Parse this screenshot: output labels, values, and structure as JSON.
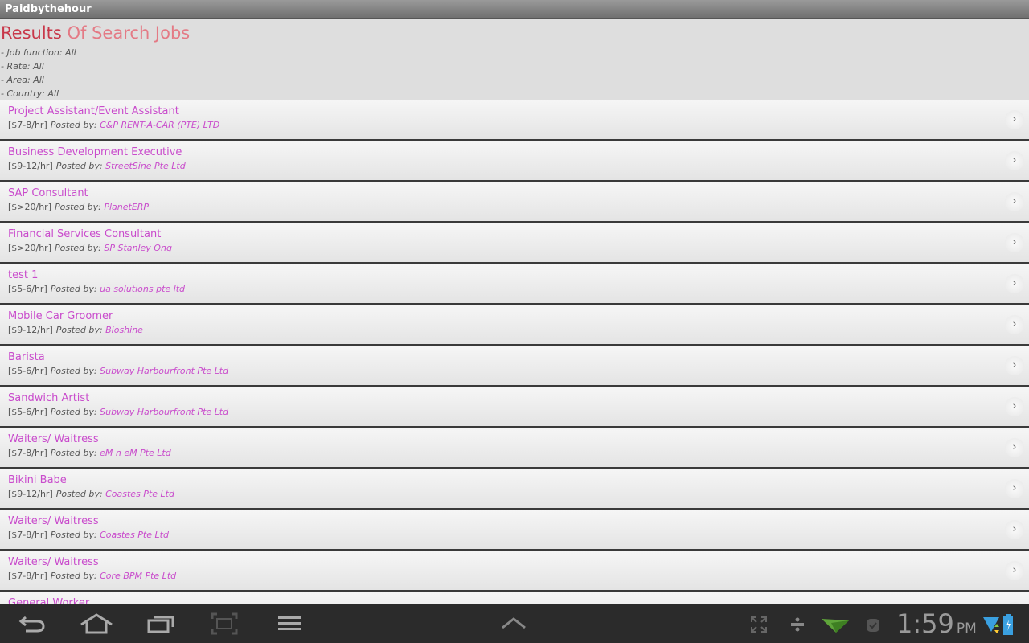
{
  "app": {
    "title": "Paidbythehour"
  },
  "header": {
    "title_part1": "Results",
    "title_part2": " Of Search Jobs",
    "filters": [
      "- Job function: All",
      "- Rate: All",
      "- Area: All",
      "- Country: All"
    ]
  },
  "poster_label": "Posted by:",
  "jobs": [
    {
      "title": "Project Assistant/Event Assistant",
      "rate": "[$7-8/hr]",
      "poster": "C&P RENT-A-CAR (PTE) LTD"
    },
    {
      "title": "Business Development Executive",
      "rate": "[$9-12/hr]",
      "poster": "StreetSine Pte Ltd"
    },
    {
      "title": "SAP Consultant",
      "rate": "[$>20/hr]",
      "poster": "PlanetERP"
    },
    {
      "title": "Financial Services Consultant",
      "rate": "[$>20/hr]",
      "poster": "SP Stanley Ong"
    },
    {
      "title": "test 1",
      "rate": "[$5-6/hr]",
      "poster": "ua solutions pte ltd"
    },
    {
      "title": "Mobile Car Groomer",
      "rate": "[$9-12/hr]",
      "poster": "Bioshine"
    },
    {
      "title": "Barista",
      "rate": "[$5-6/hr]",
      "poster": "Subway Harbourfront Pte Ltd"
    },
    {
      "title": "Sandwich Artist",
      "rate": "[$5-6/hr]",
      "poster": "Subway Harbourfront Pte Ltd"
    },
    {
      "title": "Waiters/ Waitress",
      "rate": "[$7-8/hr]",
      "poster": "eM n eM Pte Ltd"
    },
    {
      "title": "Bikini Babe",
      "rate": "[$9-12/hr]",
      "poster": "Coastes Pte Ltd"
    },
    {
      "title": "Waiters/ Waitress",
      "rate": "[$7-8/hr]",
      "poster": "Coastes Pte Ltd"
    },
    {
      "title": "Waiters/ Waitress",
      "rate": "[$7-8/hr]",
      "poster": "Core BPM Pte Ltd"
    },
    {
      "title": "General Worker",
      "rate": "",
      "poster": ""
    }
  ],
  "chevron_glyph": "›",
  "status": {
    "time": "1:59",
    "ampm": "PM"
  },
  "nav_icons": [
    "back-icon",
    "home-icon",
    "recent-apps-icon",
    "screenshot-icon",
    "menu-icon",
    "up-chevron-icon"
  ],
  "colors": {
    "accent": "#c94ccc",
    "title_red": "#c8384a",
    "title_pink": "#e47a85"
  }
}
